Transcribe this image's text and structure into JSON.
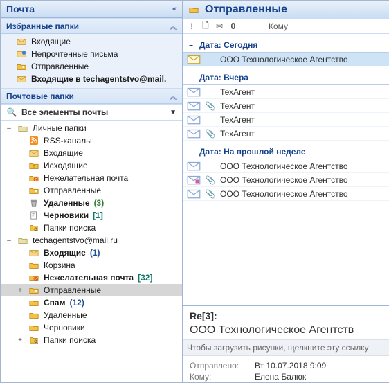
{
  "left": {
    "title": "Почта",
    "favorites_header": "Избранные папки",
    "favorites": [
      {
        "icon": "inbox",
        "label": "Входящие",
        "bold": false
      },
      {
        "icon": "unread",
        "label": "Непрочтенные письма",
        "bold": false
      },
      {
        "icon": "sent",
        "label": "Отправленные",
        "bold": false
      },
      {
        "icon": "inbox",
        "label": "Входящие в techagentstvo@mail.",
        "bold": true
      }
    ],
    "mail_folders_header": "Почтовые папки",
    "all_items_label": "Все элементы почты",
    "tree": [
      {
        "lvl": 0,
        "tw": "–",
        "icon": "pst",
        "label": "Личные папки",
        "bold": false
      },
      {
        "lvl": 1,
        "tw": "",
        "icon": "rss",
        "label": "RSS-каналы",
        "bold": false
      },
      {
        "lvl": 1,
        "tw": "",
        "icon": "inbox",
        "label": "Входящие",
        "bold": false
      },
      {
        "lvl": 1,
        "tw": "",
        "icon": "outbox",
        "label": "Исходящие",
        "bold": false
      },
      {
        "lvl": 1,
        "tw": "",
        "icon": "junk",
        "label": "Нежелательная почта",
        "bold": false
      },
      {
        "lvl": 1,
        "tw": "",
        "icon": "sent",
        "label": "Отправленные",
        "bold": false
      },
      {
        "lvl": 1,
        "tw": "",
        "icon": "trash",
        "label": "Удаленные",
        "bold": true,
        "count": "(3)",
        "countCls": "cnt-green"
      },
      {
        "lvl": 1,
        "tw": "",
        "icon": "drafts",
        "label": "Черновики",
        "bold": true,
        "count": "[1]",
        "countCls": "cnt-teal"
      },
      {
        "lvl": 1,
        "tw": "",
        "icon": "search",
        "label": "Папки поиска",
        "bold": false
      },
      {
        "lvl": 0,
        "tw": "–",
        "icon": "pst",
        "label": "techagentstvo@mail.ru",
        "bold": false
      },
      {
        "lvl": 1,
        "tw": "",
        "icon": "inbox",
        "label": "Входящие",
        "bold": true,
        "count": "(1)",
        "countCls": "cnt-blue"
      },
      {
        "lvl": 1,
        "tw": "",
        "icon": "folder",
        "label": "Корзина",
        "bold": false
      },
      {
        "lvl": 1,
        "tw": "",
        "icon": "junk",
        "label": "Нежелательная почта",
        "bold": true,
        "count": "[32]",
        "countCls": "cnt-teal"
      },
      {
        "lvl": 1,
        "tw": "+",
        "icon": "sent",
        "label": "Отправленные",
        "bold": false,
        "selected": true
      },
      {
        "lvl": 1,
        "tw": "",
        "icon": "folder",
        "label": "Спам",
        "bold": true,
        "count": "(12)",
        "countCls": "cnt-blue"
      },
      {
        "lvl": 1,
        "tw": "",
        "icon": "folder",
        "label": "Удаленные",
        "bold": false
      },
      {
        "lvl": 1,
        "tw": "",
        "icon": "folder",
        "label": "Черновики",
        "bold": false
      },
      {
        "lvl": 1,
        "tw": "+",
        "icon": "search",
        "label": "Папки поиска",
        "bold": false
      }
    ]
  },
  "right": {
    "title": "Отправленные",
    "cols_label": "Кому",
    "groups": [
      {
        "label": "Дата: Сегодня",
        "items": [
          {
            "icon": "mail-open",
            "attach": false,
            "text": "ООО Технологическое Агентство",
            "selected": true
          }
        ]
      },
      {
        "label": "Дата: Вчера",
        "items": [
          {
            "icon": "mail",
            "attach": false,
            "text": "ТехАгент"
          },
          {
            "icon": "mail",
            "attach": true,
            "text": "ТехАгент"
          },
          {
            "icon": "mail",
            "attach": false,
            "text": "ТехАгент"
          },
          {
            "icon": "mail",
            "attach": true,
            "text": "ТехАгент"
          }
        ]
      },
      {
        "label": "Дата: На прошлой неделе",
        "items": [
          {
            "icon": "mail",
            "attach": false,
            "text": "ООО Технологическое Агентство"
          },
          {
            "icon": "mail-flag",
            "attach": true,
            "text": "ООО Технологическое Агентство"
          },
          {
            "icon": "mail",
            "attach": true,
            "text": "ООО Технологическое Агентство"
          }
        ]
      }
    ],
    "preview": {
      "subject": "Re[3]:",
      "from": "ООО Технологическое Агентств",
      "blocked_images": "Чтобы загрузить рисунки, щелкните эту ссылку",
      "sent_label": "Отправлено:",
      "sent_value": "Вт 10.07.2018 9:09",
      "to_label": "Кому:",
      "to_value": "Елена Балюк"
    }
  }
}
